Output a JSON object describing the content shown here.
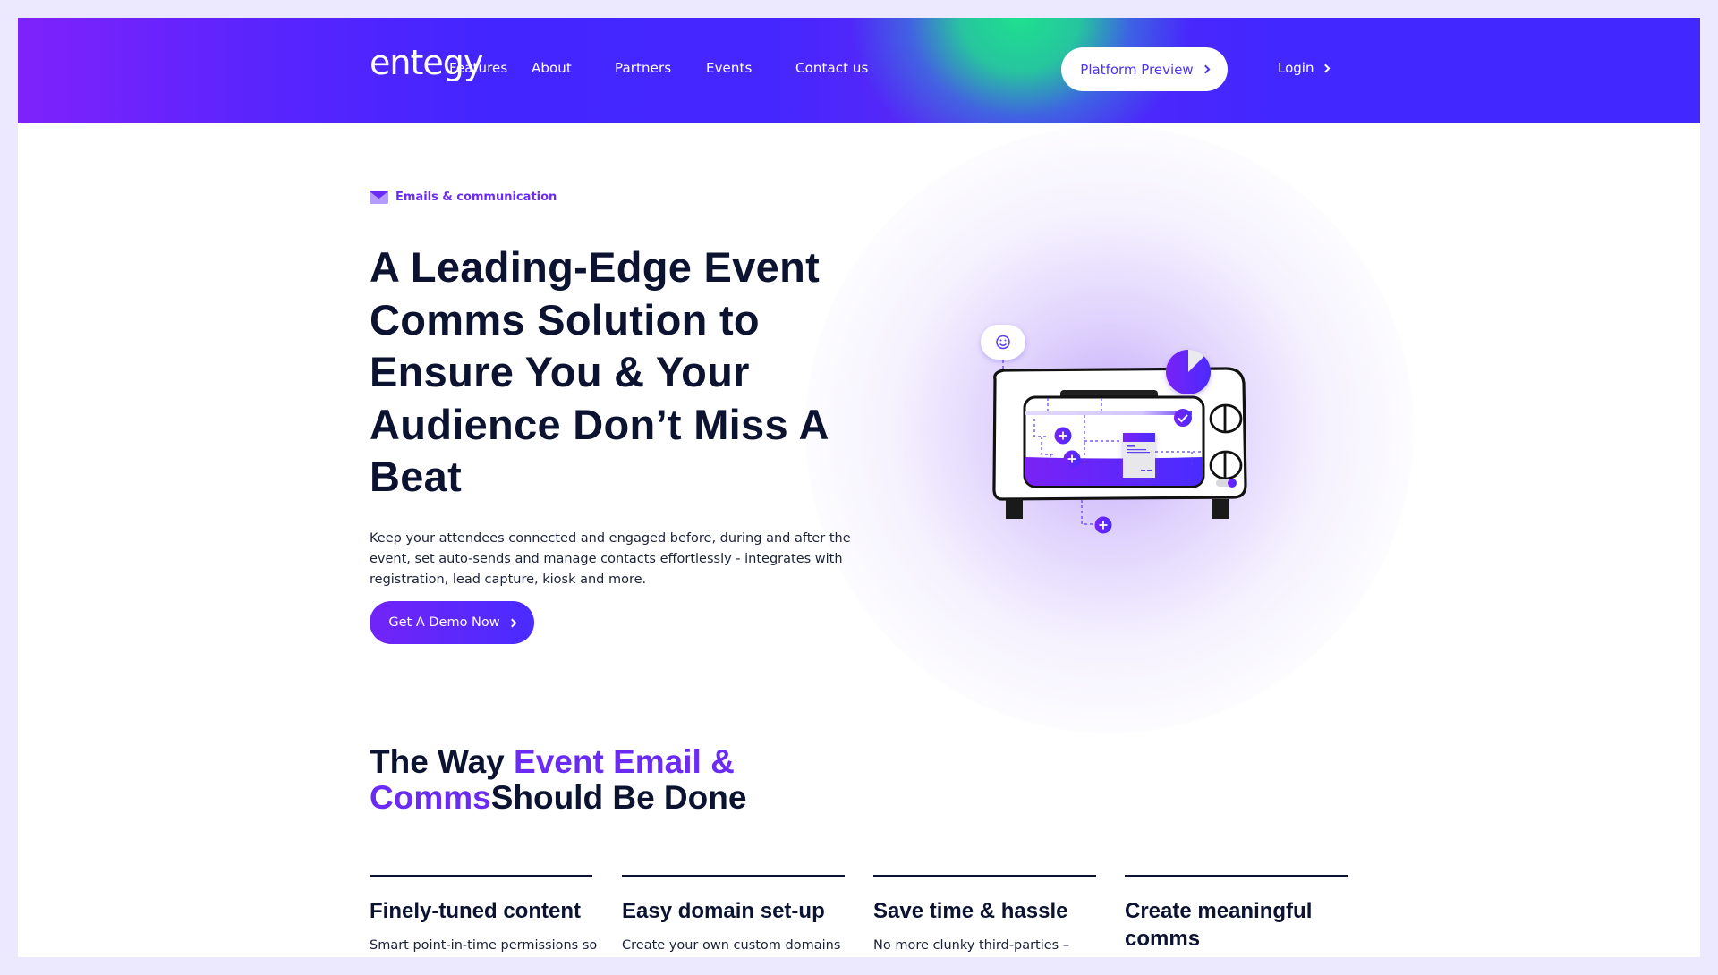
{
  "header": {
    "logo": "entegy",
    "nav": [
      {
        "label": "Features"
      },
      {
        "label": "About"
      },
      {
        "label": "Partners"
      },
      {
        "label": "Events"
      },
      {
        "label": "Contact us"
      }
    ],
    "preview_button": "Platform Preview",
    "login": "Login"
  },
  "hero": {
    "tag": "Emails & communication",
    "tag_icon": "envelope-icon",
    "title": "A Leading-Edge Event Comms Solution to Ensure You & Your Audience Don’t Miss A Beat",
    "description": "Keep your attendees connected and engaged before, during and after the event, set auto-sends and manage contacts effortlessly - integrates with registration, lead capture, kiosk and more.",
    "cta": "Get A Demo Now",
    "illustration": {
      "subject": "toaster-oven-icon",
      "pie_progress_fraction": 0.875
    }
  },
  "section": {
    "title_part1": "The Way ",
    "title_accent": "Event Email & Comms",
    "title_part2": "Should Be Done",
    "features": [
      {
        "title": "Finely-tuned content",
        "desc": "Smart point-in-time permissions so"
      },
      {
        "title": "Easy domain set-up",
        "desc": "Create your own custom domains"
      },
      {
        "title": "Save time & hassle",
        "desc": "No more clunky third-parties –"
      },
      {
        "title": "Create meaningful comms",
        "desc": ""
      }
    ]
  },
  "colors": {
    "brand_violet": "#6a2cf5",
    "brand_blue": "#4227ff",
    "brand_green": "#1ee08f",
    "text_dark": "#0b1330",
    "frame": "#ece8fe"
  }
}
